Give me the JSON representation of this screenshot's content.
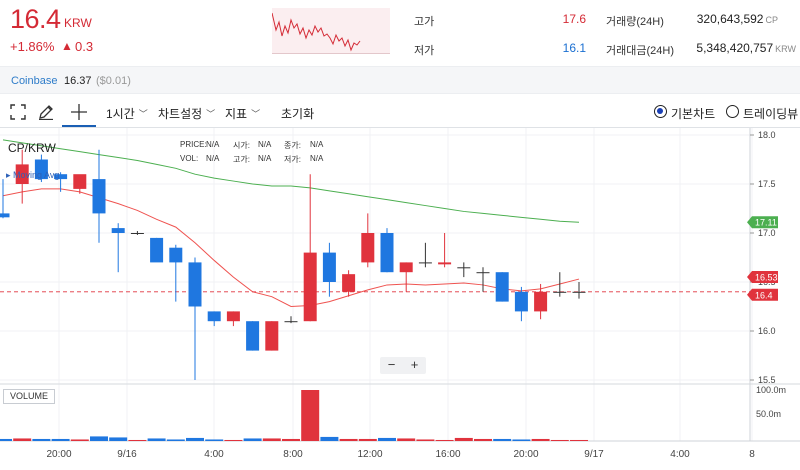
{
  "header": {
    "price": "16.4",
    "currency": "KRW",
    "change_pct": "+1.86%",
    "change_tri": "▲",
    "change_abs": "0.3",
    "high_label": "고가",
    "high_value": "17.6",
    "low_label": "저가",
    "low_value": "16.1",
    "volume_label": "거래량(24H)",
    "volume_value": "320,643,592",
    "volume_unit": "CP",
    "amount_label": "거래대금(24H)",
    "amount_value": "5,348,420,757",
    "amount_unit": "KRW"
  },
  "exchange": {
    "name": "Coinbase",
    "price": "16.37",
    "diff": "($0.01)"
  },
  "toolbar": {
    "interval": "1시간",
    "chart_settings": "차트설정",
    "indicators": "지표",
    "reset": "초기화",
    "basic_chart": "기본차트",
    "tradingview": "트레이딩뷰"
  },
  "chart": {
    "symbol": "CP/KRW",
    "indicator_legend": "▸ Moving Avg",
    "ohlc": {
      "price_label": "PRICE:",
      "price_val": "N/A",
      "vol_label": "VOL:",
      "vol_val": "N/A",
      "open_label": "시가:",
      "open_val": "N/A",
      "high_label": "고가:",
      "high_val": "N/A",
      "close_label": "종가:",
      "close_val": "N/A",
      "low_label": "저가:",
      "low_val": "N/A"
    },
    "zoom_out": "−",
    "zoom_in": "+",
    "volume_label": "VOLUME",
    "colors": {
      "up": "#e0333d",
      "down": "#1f77e0",
      "ma_fast": "#ef5350",
      "ma_slow": "#4caf50",
      "current_price_line": "#e0333d"
    }
  },
  "chart_data": {
    "type": "candlestick",
    "title": "CP/KRW",
    "y_ticks": [
      "18.0",
      "17.5",
      "17.0",
      "16.5",
      "16.0",
      "15.5"
    ],
    "ylim": [
      15.5,
      18.0
    ],
    "volume_ticks": [
      "100.0m",
      "50.0m"
    ],
    "x_ticks": [
      "20:00",
      "9/16",
      "4:00",
      "8:00",
      "12:00",
      "16:00",
      "20:00",
      "9/17",
      "4:00",
      "8"
    ],
    "price_tags": [
      {
        "text": "17.11",
        "value": 17.11,
        "color": "#4caf50"
      },
      {
        "text": "16.53",
        "value": 16.53,
        "color": "#e0333d"
      },
      {
        "text": "16.4",
        "value": 16.4,
        "color": "#e0333d"
      }
    ],
    "candles": [
      {
        "o": 17.2,
        "h": 17.55,
        "l": 17.15,
        "c": 17.16,
        "v": 4
      },
      {
        "o": 17.5,
        "h": 17.85,
        "l": 17.3,
        "c": 17.7,
        "v": 5
      },
      {
        "o": 17.75,
        "h": 17.8,
        "l": 17.52,
        "c": 17.55,
        "v": 4
      },
      {
        "o": 17.6,
        "h": 17.62,
        "l": 17.42,
        "c": 17.55,
        "v": 4
      },
      {
        "o": 17.45,
        "h": 17.55,
        "l": 17.4,
        "c": 17.6,
        "v": 3
      },
      {
        "o": 17.55,
        "h": 17.85,
        "l": 16.9,
        "c": 17.2,
        "v": 9
      },
      {
        "o": 17.05,
        "h": 17.1,
        "l": 16.6,
        "c": 17.0,
        "v": 7
      },
      {
        "o": 17.0,
        "h": 17.02,
        "l": 16.98,
        "c": 17.0,
        "v": 2
      },
      {
        "o": 16.95,
        "h": 16.95,
        "l": 16.85,
        "c": 16.7,
        "v": 5
      },
      {
        "o": 16.85,
        "h": 16.88,
        "l": 16.3,
        "c": 16.7,
        "v": 3
      },
      {
        "o": 16.7,
        "h": 16.75,
        "l": 15.5,
        "c": 16.25,
        "v": 6
      },
      {
        "o": 16.2,
        "h": 16.2,
        "l": 16.05,
        "c": 16.1,
        "v": 3
      },
      {
        "o": 16.1,
        "h": 16.2,
        "l": 16.05,
        "c": 16.2,
        "v": 2
      },
      {
        "o": 16.1,
        "h": 16.1,
        "l": 15.8,
        "c": 15.8,
        "v": 5
      },
      {
        "o": 15.8,
        "h": 16.1,
        "l": 15.8,
        "c": 16.1,
        "v": 5
      },
      {
        "o": 16.1,
        "h": 16.15,
        "l": 16.08,
        "c": 16.1,
        "v": 4
      },
      {
        "o": 16.1,
        "h": 17.6,
        "l": 16.1,
        "c": 16.8,
        "v": 100
      },
      {
        "o": 16.8,
        "h": 16.9,
        "l": 16.35,
        "c": 16.5,
        "v": 8
      },
      {
        "o": 16.4,
        "h": 16.62,
        "l": 16.35,
        "c": 16.58,
        "v": 4
      },
      {
        "o": 16.7,
        "h": 17.2,
        "l": 16.65,
        "c": 17.0,
        "v": 4
      },
      {
        "o": 17.0,
        "h": 17.05,
        "l": 16.6,
        "c": 16.6,
        "v": 6
      },
      {
        "o": 16.6,
        "h": 16.7,
        "l": 16.4,
        "c": 16.7,
        "v": 5
      },
      {
        "o": 16.7,
        "h": 16.9,
        "l": 16.65,
        "c": 16.7,
        "v": 3
      },
      {
        "o": 16.68,
        "h": 17.0,
        "l": 16.65,
        "c": 16.7,
        "v": 2
      },
      {
        "o": 16.65,
        "h": 16.7,
        "l": 16.55,
        "c": 16.65,
        "v": 6
      },
      {
        "o": 16.6,
        "h": 16.65,
        "l": 16.4,
        "c": 16.6,
        "v": 4
      },
      {
        "o": 16.6,
        "h": 16.6,
        "l": 16.3,
        "c": 16.3,
        "v": 4
      },
      {
        "o": 16.4,
        "h": 16.45,
        "l": 16.1,
        "c": 16.2,
        "v": 3
      },
      {
        "o": 16.2,
        "h": 16.48,
        "l": 16.12,
        "c": 16.4,
        "v": 4
      },
      {
        "o": 16.4,
        "h": 16.6,
        "l": 16.35,
        "c": 16.4,
        "v": 2
      },
      {
        "o": 16.4,
        "h": 16.5,
        "l": 16.33,
        "c": 16.4,
        "v": 2
      }
    ],
    "ma_fast": [
      17.38,
      17.42,
      17.45,
      17.45,
      17.42,
      17.36,
      17.3,
      17.23,
      17.14,
      17.06,
      16.9,
      16.72,
      16.55,
      16.4,
      16.35,
      16.25,
      16.26,
      16.3,
      16.36,
      16.42,
      16.47,
      16.48,
      16.47,
      16.48,
      16.49,
      16.47,
      16.43,
      16.41,
      16.43,
      16.48,
      16.53
    ],
    "ma_slow": [
      17.95,
      17.92,
      17.89,
      17.86,
      17.83,
      17.8,
      17.77,
      17.74,
      17.7,
      17.66,
      17.6,
      17.56,
      17.53,
      17.5,
      17.48,
      17.48,
      17.46,
      17.43,
      17.4,
      17.37,
      17.34,
      17.31,
      17.28,
      17.25,
      17.22,
      17.2,
      17.18,
      17.16,
      17.14,
      17.12,
      17.11
    ]
  }
}
